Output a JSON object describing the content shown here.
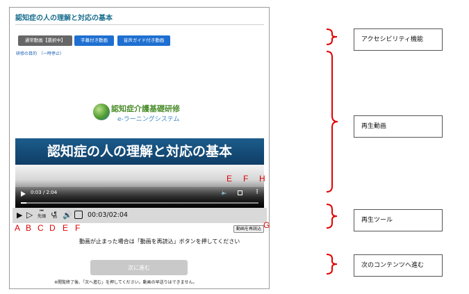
{
  "page": {
    "title": "認知症の人の理解と対応の基本"
  },
  "modes": {
    "normal": "通常動画【選択中】",
    "subtitle": "字幕付き動画",
    "audio_guide": "音声ガイド付き動画"
  },
  "purpose_link": "研修の目的　（一時停止）",
  "video": {
    "logo_line1": "認知症介護基礎研修",
    "logo_line2": "e-ラーニングシステム",
    "banner_title": "認知症の人の理解と対応の基本",
    "native_time": "0:03 / 2:04",
    "progress": 0.024
  },
  "native_labels": {
    "e": "E",
    "f": "F",
    "h": "H"
  },
  "toolbar": {
    "time": "00:03/02:04",
    "skip_label": "先頭",
    "rewind_seconds": "10"
  },
  "toolbar_labels": {
    "a": "A",
    "b": "B",
    "c": "C",
    "d": "D",
    "e": "E",
    "f": "F",
    "g": "G"
  },
  "reload_button": "動画を再読込",
  "reload_hint": "動画が止まった場合は「動画を再読込」ボタンを押してください",
  "next_button": "次に進む",
  "note": "※閲覧終了後、「次へ進む」を押してください。動画の早送りはできません。",
  "annotations": {
    "accessibility": "アクセシビリティ機能",
    "video": "再生動画",
    "tools": "再生ツール",
    "next": "次のコンテンツへ進む"
  },
  "colors": {
    "accent": "#1e6fd1",
    "title": "#1a6e8e",
    "annotation_red": "#e00000"
  }
}
